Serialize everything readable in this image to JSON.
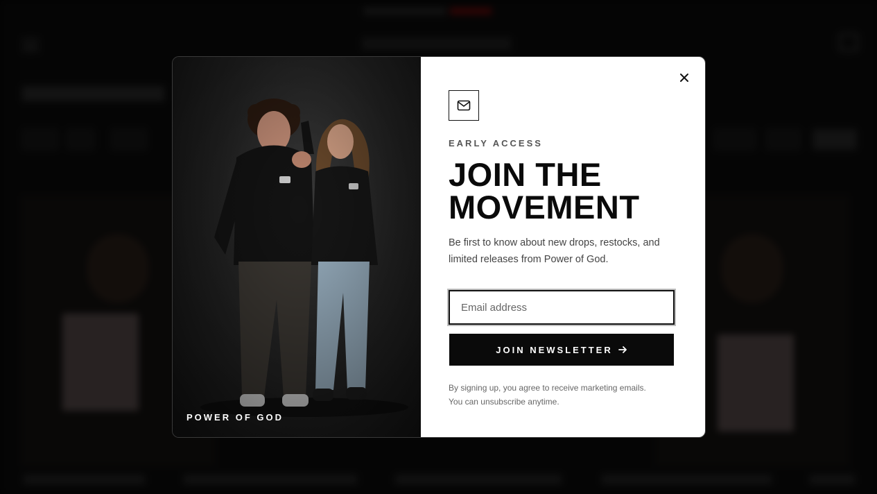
{
  "modal": {
    "eyebrow": "EARLY ACCESS",
    "headline_line1": "JOIN THE",
    "headline_line2": "MOVEMENT",
    "description": "Be first to know about new drops, restocks, and limited releases from Power of God.",
    "email_placeholder": "Email address",
    "submit_label": "JOIN NEWSLETTER",
    "fineprint_line1": "By signing up, you agree to receive marketing emails.",
    "fineprint_line2": "You can unsubscribe anytime.",
    "image_caption": "POWER OF GOD",
    "icons": {
      "close": "close-icon",
      "mail": "mail-icon",
      "submit_arrow": "arrow-right-icon"
    },
    "colors": {
      "button_bg": "#0a0a0a",
      "panel_bg": "#ffffff"
    }
  }
}
